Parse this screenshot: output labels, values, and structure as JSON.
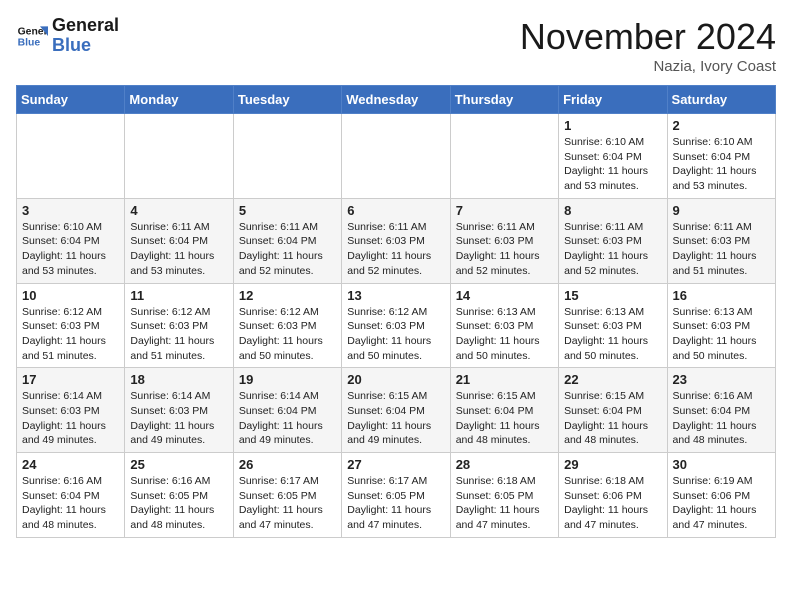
{
  "header": {
    "logo_line1": "General",
    "logo_line2": "Blue",
    "month": "November 2024",
    "location": "Nazia, Ivory Coast"
  },
  "weekdays": [
    "Sunday",
    "Monday",
    "Tuesday",
    "Wednesday",
    "Thursday",
    "Friday",
    "Saturday"
  ],
  "weeks": [
    [
      {
        "day": "",
        "info": ""
      },
      {
        "day": "",
        "info": ""
      },
      {
        "day": "",
        "info": ""
      },
      {
        "day": "",
        "info": ""
      },
      {
        "day": "",
        "info": ""
      },
      {
        "day": "1",
        "info": "Sunrise: 6:10 AM\nSunset: 6:04 PM\nDaylight: 11 hours\nand 53 minutes."
      },
      {
        "day": "2",
        "info": "Sunrise: 6:10 AM\nSunset: 6:04 PM\nDaylight: 11 hours\nand 53 minutes."
      }
    ],
    [
      {
        "day": "3",
        "info": "Sunrise: 6:10 AM\nSunset: 6:04 PM\nDaylight: 11 hours\nand 53 minutes."
      },
      {
        "day": "4",
        "info": "Sunrise: 6:11 AM\nSunset: 6:04 PM\nDaylight: 11 hours\nand 53 minutes."
      },
      {
        "day": "5",
        "info": "Sunrise: 6:11 AM\nSunset: 6:04 PM\nDaylight: 11 hours\nand 52 minutes."
      },
      {
        "day": "6",
        "info": "Sunrise: 6:11 AM\nSunset: 6:03 PM\nDaylight: 11 hours\nand 52 minutes."
      },
      {
        "day": "7",
        "info": "Sunrise: 6:11 AM\nSunset: 6:03 PM\nDaylight: 11 hours\nand 52 minutes."
      },
      {
        "day": "8",
        "info": "Sunrise: 6:11 AM\nSunset: 6:03 PM\nDaylight: 11 hours\nand 52 minutes."
      },
      {
        "day": "9",
        "info": "Sunrise: 6:11 AM\nSunset: 6:03 PM\nDaylight: 11 hours\nand 51 minutes."
      }
    ],
    [
      {
        "day": "10",
        "info": "Sunrise: 6:12 AM\nSunset: 6:03 PM\nDaylight: 11 hours\nand 51 minutes."
      },
      {
        "day": "11",
        "info": "Sunrise: 6:12 AM\nSunset: 6:03 PM\nDaylight: 11 hours\nand 51 minutes."
      },
      {
        "day": "12",
        "info": "Sunrise: 6:12 AM\nSunset: 6:03 PM\nDaylight: 11 hours\nand 50 minutes."
      },
      {
        "day": "13",
        "info": "Sunrise: 6:12 AM\nSunset: 6:03 PM\nDaylight: 11 hours\nand 50 minutes."
      },
      {
        "day": "14",
        "info": "Sunrise: 6:13 AM\nSunset: 6:03 PM\nDaylight: 11 hours\nand 50 minutes."
      },
      {
        "day": "15",
        "info": "Sunrise: 6:13 AM\nSunset: 6:03 PM\nDaylight: 11 hours\nand 50 minutes."
      },
      {
        "day": "16",
        "info": "Sunrise: 6:13 AM\nSunset: 6:03 PM\nDaylight: 11 hours\nand 50 minutes."
      }
    ],
    [
      {
        "day": "17",
        "info": "Sunrise: 6:14 AM\nSunset: 6:03 PM\nDaylight: 11 hours\nand 49 minutes."
      },
      {
        "day": "18",
        "info": "Sunrise: 6:14 AM\nSunset: 6:03 PM\nDaylight: 11 hours\nand 49 minutes."
      },
      {
        "day": "19",
        "info": "Sunrise: 6:14 AM\nSunset: 6:04 PM\nDaylight: 11 hours\nand 49 minutes."
      },
      {
        "day": "20",
        "info": "Sunrise: 6:15 AM\nSunset: 6:04 PM\nDaylight: 11 hours\nand 49 minutes."
      },
      {
        "day": "21",
        "info": "Sunrise: 6:15 AM\nSunset: 6:04 PM\nDaylight: 11 hours\nand 48 minutes."
      },
      {
        "day": "22",
        "info": "Sunrise: 6:15 AM\nSunset: 6:04 PM\nDaylight: 11 hours\nand 48 minutes."
      },
      {
        "day": "23",
        "info": "Sunrise: 6:16 AM\nSunset: 6:04 PM\nDaylight: 11 hours\nand 48 minutes."
      }
    ],
    [
      {
        "day": "24",
        "info": "Sunrise: 6:16 AM\nSunset: 6:04 PM\nDaylight: 11 hours\nand 48 minutes."
      },
      {
        "day": "25",
        "info": "Sunrise: 6:16 AM\nSunset: 6:05 PM\nDaylight: 11 hours\nand 48 minutes."
      },
      {
        "day": "26",
        "info": "Sunrise: 6:17 AM\nSunset: 6:05 PM\nDaylight: 11 hours\nand 47 minutes."
      },
      {
        "day": "27",
        "info": "Sunrise: 6:17 AM\nSunset: 6:05 PM\nDaylight: 11 hours\nand 47 minutes."
      },
      {
        "day": "28",
        "info": "Sunrise: 6:18 AM\nSunset: 6:05 PM\nDaylight: 11 hours\nand 47 minutes."
      },
      {
        "day": "29",
        "info": "Sunrise: 6:18 AM\nSunset: 6:06 PM\nDaylight: 11 hours\nand 47 minutes."
      },
      {
        "day": "30",
        "info": "Sunrise: 6:19 AM\nSunset: 6:06 PM\nDaylight: 11 hours\nand 47 minutes."
      }
    ]
  ]
}
